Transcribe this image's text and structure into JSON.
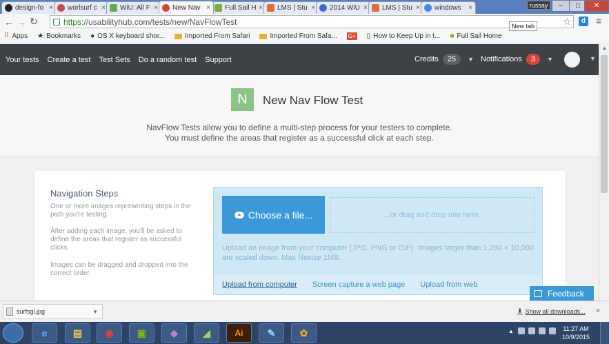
{
  "browser": {
    "tabs": [
      {
        "label": "design-fo",
        "color": "#222222",
        "active": false
      },
      {
        "label": "worlsurf c",
        "color": "#c84a4a",
        "active": false
      },
      {
        "label": "WiU: All F",
        "color": "#6aa84f",
        "active": false
      },
      {
        "label": "New Nav",
        "color": "#d9453d",
        "active": true
      },
      {
        "label": "Full Sail H",
        "color": "#79b13a",
        "active": false
      },
      {
        "label": "LMS | Stu",
        "color": "#e06f3b",
        "active": false
      },
      {
        "label": "2014 WiU",
        "color": "#3b6ec9",
        "active": false
      },
      {
        "label": "LMS | Stu",
        "color": "#e06f3b",
        "active": false
      },
      {
        "label": "windows",
        "color": "#4285f4",
        "active": false
      }
    ],
    "tab_close_glyph": "×",
    "window_user": "russay",
    "url_scheme": "https://",
    "url_rest": "usabilityhub.com/tests/new/NavFlowTest",
    "new_tab_tooltip": "New tab",
    "bookmarks": [
      {
        "label": "Apps",
        "icon": "apps-grid"
      },
      {
        "label": "Bookmarks",
        "icon": "star"
      },
      {
        "label": "OS X keyboard shor...",
        "icon": "apple"
      },
      {
        "label": "Imported From Safari",
        "icon": "folder"
      },
      {
        "label": "Imported From Safa...",
        "icon": "folder"
      },
      {
        "label": "G+",
        "icon": "google-plus"
      },
      {
        "label": "How to Keep Up in t...",
        "icon": "page"
      },
      {
        "label": "Full Sail Home",
        "icon": "full-sail"
      }
    ]
  },
  "site_nav": {
    "links": [
      "Your tests",
      "Create a test",
      "Test Sets",
      "Do a random test",
      "Support"
    ],
    "credits_label": "Credits",
    "credits_count": "25",
    "notifications_label": "Notifications",
    "notifications_count": "3"
  },
  "header": {
    "badge": "N",
    "title": "New Nav Flow Test",
    "desc_line1": "NavFlow Tests allow you to define a multi-step process for your testers to complete.",
    "desc_line2": "You must define the areas that register as a successful click at each step."
  },
  "steps": {
    "title": "Navigation Steps",
    "p1": "One or more images representing steps in the path you're testing.",
    "p2": "After adding each image, you'll be asked to define the areas that register as successful clicks.",
    "p3": "Images can be dragged and dropped into the correct order."
  },
  "upload": {
    "choose_label": "Choose a file...",
    "dropzone_text": "...or drag and drop one here.",
    "hint": "Upload an image from your computer (JPG, PNG or GIF). Images larger than 1,280 × 10,000 are scaled down. Max filesize 1MB.",
    "tabs": [
      "Upload from computer",
      "Screen capture a web page",
      "Upload from web"
    ]
  },
  "feedback_label": "Feedback",
  "downloads": {
    "file_name": "surfsgl.jpg",
    "show_all": "Show all downloads..."
  },
  "taskbar": {
    "time": "11:27 AM",
    "date": "10/9/2015",
    "apps": [
      "ie",
      "explorer",
      "chrome",
      "nvidia",
      "github",
      "dreamweaver",
      "illustrator",
      "notes",
      "paint"
    ]
  }
}
